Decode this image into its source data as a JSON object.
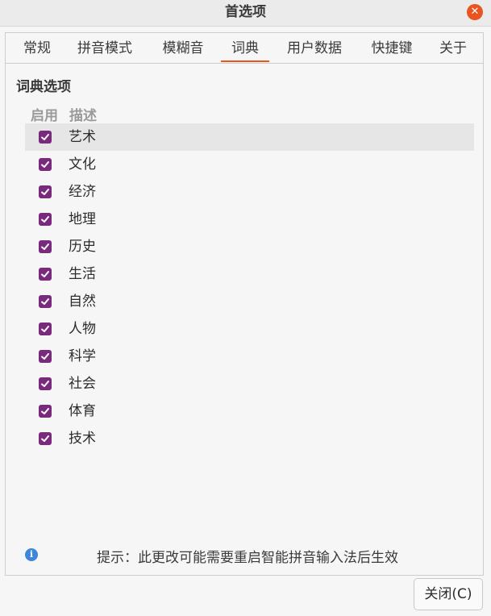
{
  "window": {
    "title": "首选项",
    "close_glyph": "✕"
  },
  "tabs": [
    {
      "label": "常规"
    },
    {
      "label": "拼音模式"
    },
    {
      "label": "模糊音"
    },
    {
      "label": "词典",
      "active": true
    },
    {
      "label": "用户数据"
    },
    {
      "label": "快捷键"
    },
    {
      "label": "关于"
    }
  ],
  "dictionary": {
    "section_title": "词典选项",
    "columns": {
      "enable": "启用",
      "description": "描述"
    },
    "items": [
      {
        "label": "艺术",
        "checked": true,
        "selected": true
      },
      {
        "label": "文化",
        "checked": true
      },
      {
        "label": "经济",
        "checked": true
      },
      {
        "label": "地理",
        "checked": true
      },
      {
        "label": "历史",
        "checked": true
      },
      {
        "label": "生活",
        "checked": true
      },
      {
        "label": "自然",
        "checked": true
      },
      {
        "label": "人物",
        "checked": true
      },
      {
        "label": "科学",
        "checked": true
      },
      {
        "label": "社会",
        "checked": true
      },
      {
        "label": "体育",
        "checked": true
      },
      {
        "label": "技术",
        "checked": true
      }
    ]
  },
  "hint": {
    "icon": "info-icon",
    "icon_glyph": "i",
    "text": "提示：此更改可能需要重启智能拼音输入法后生效"
  },
  "footer": {
    "close_label": "关闭(C)"
  },
  "colors": {
    "accent": "#e95420",
    "checkbox": "#7a2a7d",
    "info": "#3d86d8"
  }
}
